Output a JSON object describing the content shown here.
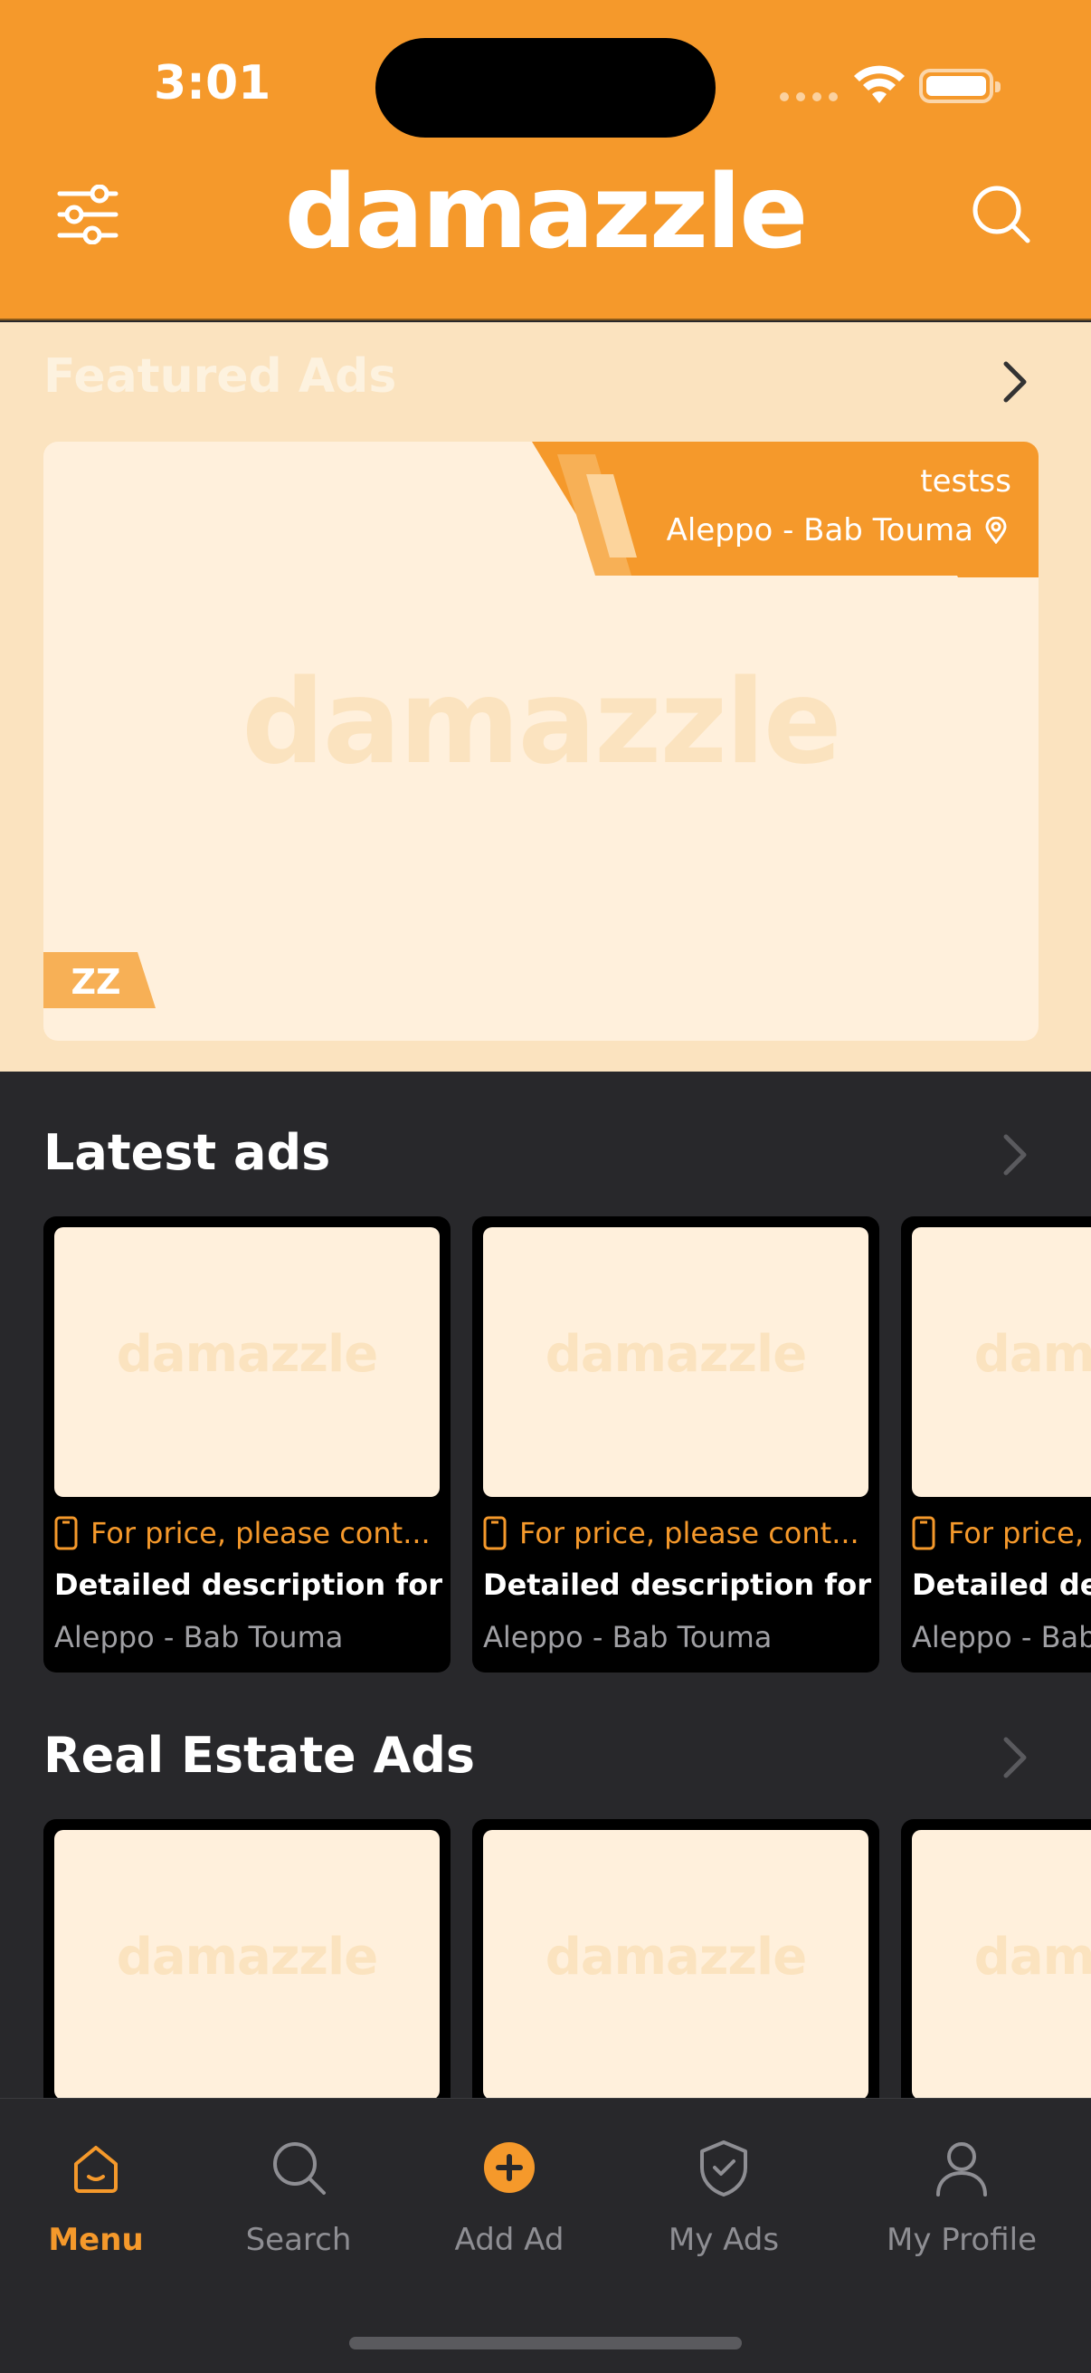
{
  "status_bar": {
    "time": "3:01"
  },
  "header": {
    "logo_text": "damazzle",
    "left_icon": "filter-sliders-icon",
    "right_icon": "search-icon"
  },
  "featured": {
    "title": "Featured Ads",
    "card": {
      "title": "testss",
      "location": "Aleppo - Bab Touma",
      "watermark": "damazzle",
      "badge": "ZZ"
    }
  },
  "latest": {
    "title": "Latest ads",
    "items": [
      {
        "price": "For price, please cont...",
        "description": "Detailed description for t...",
        "location": "Aleppo - Bab Touma",
        "watermark": "damazzle"
      },
      {
        "price": "For price, please cont...",
        "description": "Detailed description for t...",
        "location": "Aleppo - Bab Touma",
        "watermark": "damazzle"
      },
      {
        "price": "For price, please cont...",
        "description": "Detailed description for t...",
        "location": "Aleppo - Bab Touma",
        "watermark": "damazzle"
      }
    ]
  },
  "real_estate": {
    "title": "Real Estate Ads",
    "items": [
      {
        "watermark": "damazzle"
      },
      {
        "watermark": "damazzle"
      },
      {
        "watermark": "damazzle"
      }
    ]
  },
  "tabbar": {
    "items": [
      {
        "label": "Menu",
        "icon": "home-icon",
        "active": true
      },
      {
        "label": "Search",
        "icon": "search-icon",
        "active": false
      },
      {
        "label": "Add Ad",
        "icon": "plus-circle-icon",
        "active": false
      },
      {
        "label": "My Ads",
        "icon": "shield-check-icon",
        "active": false
      },
      {
        "label": "My Profile",
        "icon": "person-icon",
        "active": false
      }
    ]
  },
  "colors": {
    "brand": "#f5992b",
    "dark_bg": "#28282b",
    "cream": "#fff0dc",
    "featured_bg": "#fbe3bf"
  }
}
